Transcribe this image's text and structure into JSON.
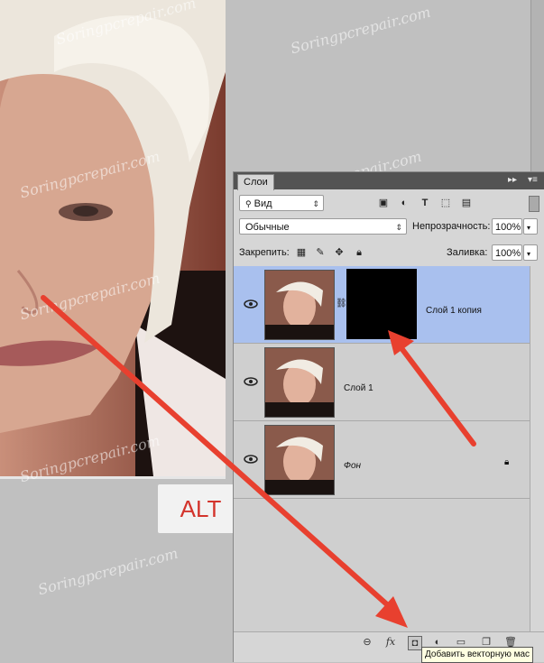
{
  "panel": {
    "tab_label": "Слои",
    "filter_dropdown": "Вид",
    "blend_mode": "Обычные",
    "opacity_label": "Непрозрачность:",
    "opacity_value": "100%",
    "lock_label": "Закрепить:",
    "fill_label": "Заливка:",
    "fill_value": "100%"
  },
  "layers": [
    {
      "name": "Слой 1 копия",
      "visible": true,
      "selected": true,
      "has_mask": true
    },
    {
      "name": "Слой 1",
      "visible": true,
      "selected": false,
      "has_mask": false
    },
    {
      "name": "Фон",
      "visible": true,
      "selected": false,
      "locked": true
    }
  ],
  "bottom_icons": [
    "link-icon",
    "fx-icon",
    "add-mask-icon",
    "adjustment-icon",
    "folder-icon",
    "new-layer-icon",
    "trash-icon"
  ],
  "tooltip": "Добавить векторную мас",
  "annotation": {
    "key_label": "ALT",
    "arrow_color": "#e8402f"
  },
  "watermark": "Soringpcrepair.com",
  "colors": {
    "selected_layer": "#a9c0ee",
    "panel_header": "#535353"
  }
}
